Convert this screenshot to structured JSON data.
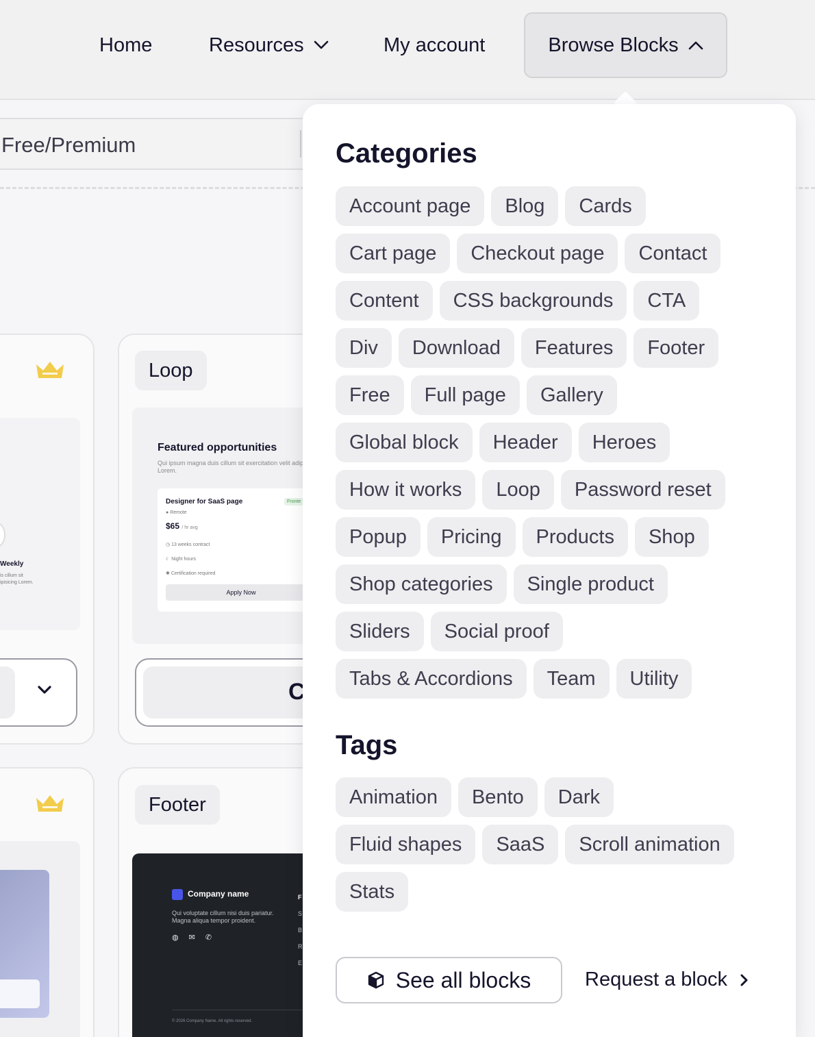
{
  "nav": {
    "home": "Home",
    "resources": "Resources",
    "my_account": "My account",
    "browse_blocks": "Browse Blocks"
  },
  "filter": {
    "label": "Free/Premium"
  },
  "cards": {
    "loop_label": "Loop",
    "footer_label": "Footer",
    "loop_preview": {
      "title": "Featured opportunities",
      "subtitle": "Qui ipsum magna duis cillum sit exercitation velit adipisicing Lorem.",
      "job_title": "Designer for SaaS page",
      "badge": "Fronte",
      "location": "Remote",
      "price": "$65",
      "price_unit": "/ hr avg",
      "contract": "13 weeks contract",
      "hours": "Night hours",
      "cert": "Certification required",
      "apply": "Apply Now"
    },
    "left_preview": {
      "weekly": "Weekly",
      "weekly_sub": "is cillum sit ipisicing Lorem."
    },
    "button_fragment": "C",
    "footer_preview": {
      "company": "Company name",
      "desc": "Qui voluptate cillum nisi duis pariatur. Magna aliqua tempor proident.",
      "copyright": "© 2026 Company Name. All rights reserved.",
      "col_head": "F",
      "col_items": [
        "S",
        "B",
        "R",
        "E"
      ]
    }
  },
  "panel": {
    "categories_heading": "Categories",
    "categories": [
      "Account page",
      "Blog",
      "Cards",
      "Cart page",
      "Checkout page",
      "Contact",
      "Content",
      "CSS backgrounds",
      "CTA",
      "Div",
      "Download",
      "Features",
      "Footer",
      "Free",
      "Full page",
      "Gallery",
      "Global block",
      "Header",
      "Heroes",
      "How it works",
      "Loop",
      "Password reset",
      "Popup",
      "Pricing",
      "Products",
      "Shop",
      "Shop categories",
      "Single product",
      "Sliders",
      "Social proof",
      "Tabs & Accordions",
      "Team",
      "Utility"
    ],
    "tags_heading": "Tags",
    "tags": [
      "Animation",
      "Bento",
      "Dark",
      "Fluid shapes",
      "SaaS",
      "Scroll animation",
      "Stats"
    ],
    "see_all": "See all blocks",
    "request": "Request a block"
  },
  "colors": {
    "chip_bg": "#eeeef0",
    "text": "#14142b",
    "crown": "#f2cc4b",
    "footer_bg": "#1f2227"
  }
}
